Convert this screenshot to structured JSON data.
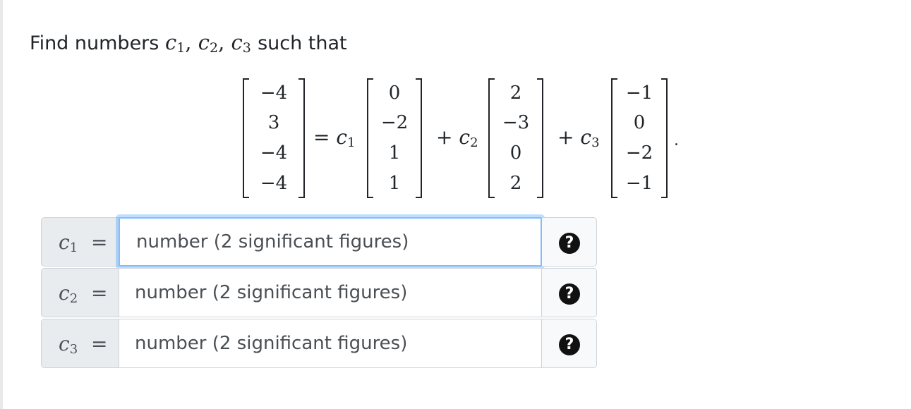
{
  "prompt": {
    "lead": "Find numbers",
    "vars": [
      "c",
      "c",
      "c"
    ],
    "subs": [
      "1",
      "2",
      "3"
    ],
    "tail": "such that"
  },
  "equation": {
    "lhs": [
      "−4",
      "3",
      "−4",
      "−4"
    ],
    "terms": [
      {
        "op": "=",
        "var": "c",
        "sub": "1",
        "vector": [
          "0",
          "−2",
          "1",
          "1"
        ]
      },
      {
        "op": "+",
        "var": "c",
        "sub": "2",
        "vector": [
          "2",
          "−3",
          "0",
          "2"
        ]
      },
      {
        "op": "+",
        "var": "c",
        "sub": "3",
        "vector": [
          "−1",
          "0",
          "−2",
          "−1"
        ]
      }
    ],
    "end": "."
  },
  "answers": [
    {
      "var": "c",
      "sub": "1",
      "eq": "=",
      "placeholder": "number (2 significant figures)",
      "value": "",
      "help": "?"
    },
    {
      "var": "c",
      "sub": "2",
      "eq": "=",
      "placeholder": "number (2 significant figures)",
      "value": "",
      "help": "?"
    },
    {
      "var": "c",
      "sub": "3",
      "eq": "=",
      "placeholder": "number (2 significant figures)",
      "value": "",
      "help": "?"
    }
  ]
}
